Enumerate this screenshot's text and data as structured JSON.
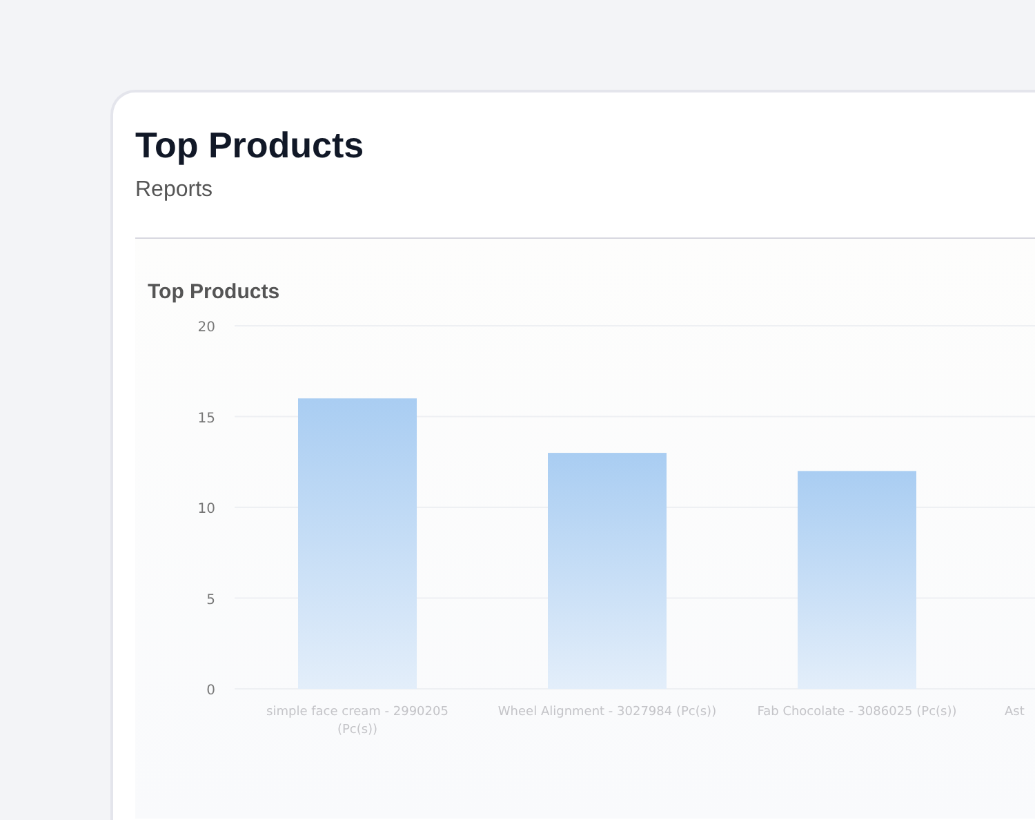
{
  "page": {
    "title": "Top Products",
    "subtitle": "Reports"
  },
  "panel": {
    "title": "Top Products",
    "chart_data": {
      "type": "bar",
      "categories": [
        "simple face cream - 2990205 (Pc(s))",
        "Wheel Alignment - 3027984 (Pc(s))",
        "Fab Chocolate - 3086025 (Pc(s))",
        "Ast"
      ],
      "values": [
        16,
        13,
        12,
        null
      ],
      "ylim": [
        0,
        20
      ],
      "yticks": [
        0,
        5,
        10,
        15,
        20
      ],
      "grid": true
    }
  }
}
